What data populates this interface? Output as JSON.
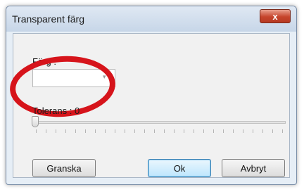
{
  "window": {
    "title": "Transparent färg",
    "close_glyph": "x"
  },
  "color": {
    "label": "Färg :",
    "value": "",
    "dropdown_glyph": "▾"
  },
  "tolerance": {
    "label": "Tolerans : 0",
    "value": 0
  },
  "buttons": {
    "browse_label": "Granska",
    "ok_label": "Ok",
    "cancel_label": "Avbryt"
  },
  "annotation": {
    "ring_color": "#d6141b"
  }
}
